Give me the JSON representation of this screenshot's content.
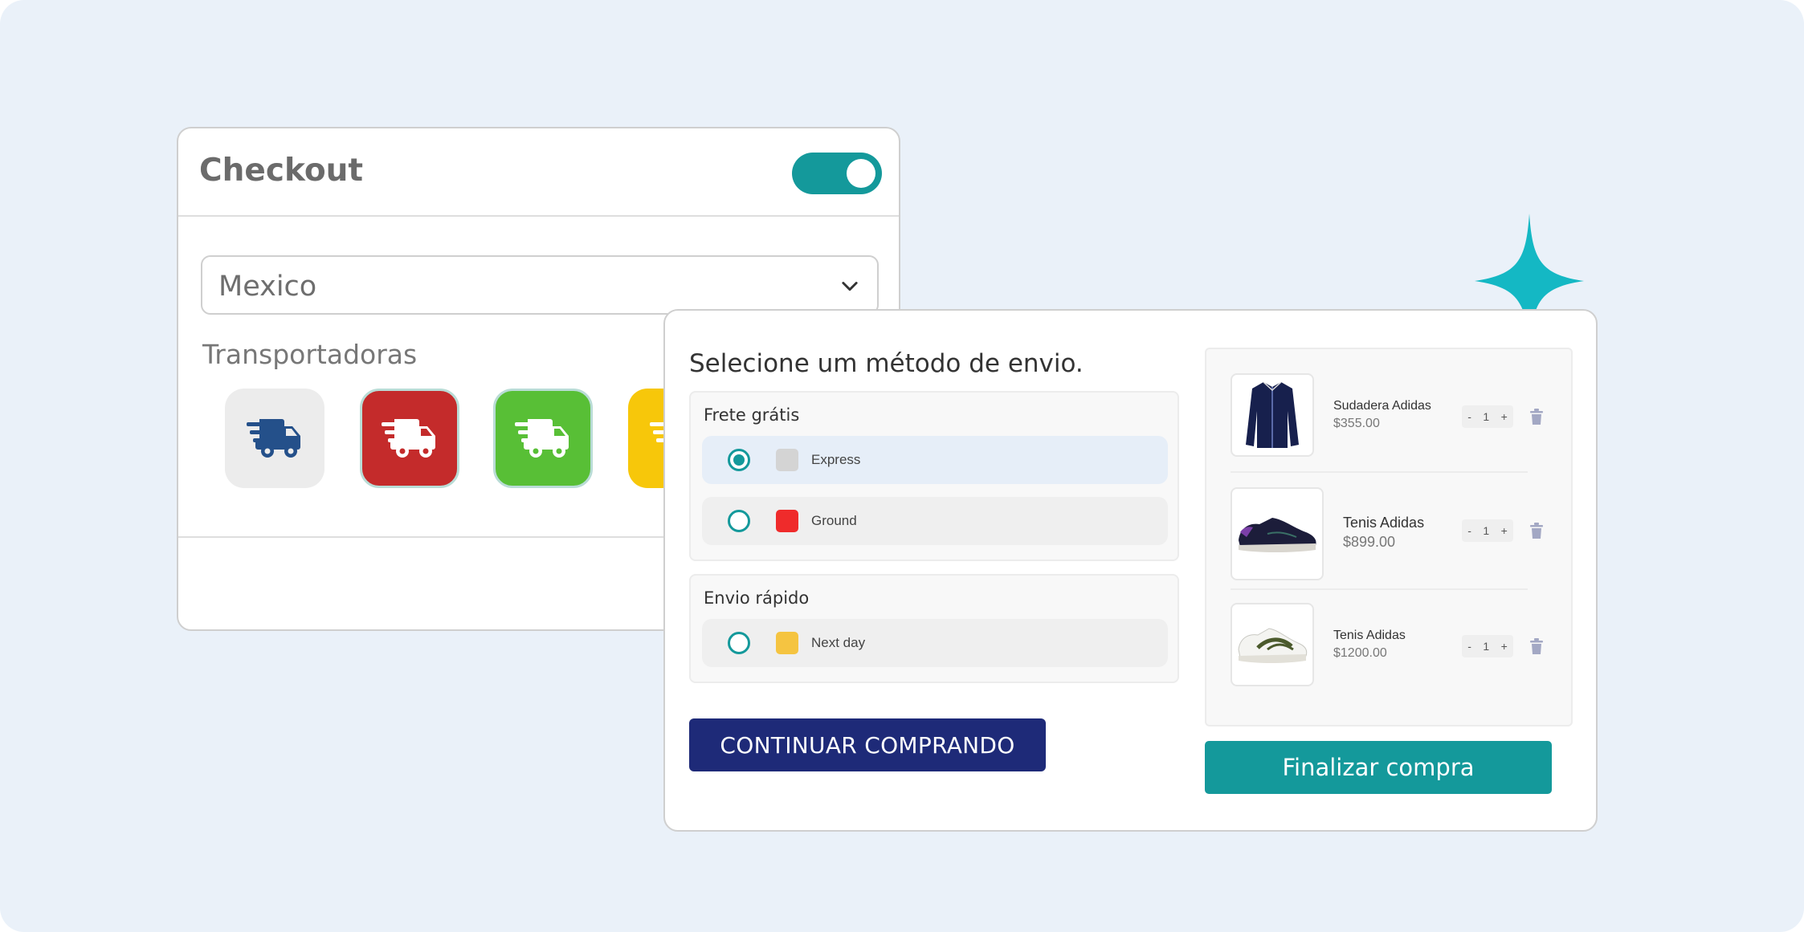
{
  "checkout": {
    "title": "Checkout",
    "toggle_on": true,
    "country_value": "Mexico",
    "carriers_label": "Transportadoras",
    "carriers": [
      {
        "icon": "truck-icon",
        "bg": "#ececec",
        "fg": "#24508a"
      },
      {
        "icon": "truck-icon",
        "bg": "#c42b2b",
        "fg": "#ffffff"
      },
      {
        "icon": "truck-icon",
        "bg": "#58bf36",
        "fg": "#ffffff"
      },
      {
        "icon": "truck-icon",
        "bg": "#f7c70a",
        "fg": "#ffffff"
      }
    ]
  },
  "shipping": {
    "title": "Selecione um método de envio.",
    "groups": [
      {
        "title": "Frete grátis",
        "options": [
          {
            "label": "Express",
            "swatch": "#d4d4d4",
            "selected": true
          },
          {
            "label": "Ground",
            "swatch": "#ef2b2b",
            "selected": false
          }
        ]
      },
      {
        "title": "Envio rápido",
        "options": [
          {
            "label": "Next day",
            "swatch": "#f5c441",
            "selected": false
          }
        ]
      }
    ],
    "continue_label": "CONTINUAR COMPRANDO"
  },
  "cart": {
    "items": [
      {
        "name": "Sudadera Adidas",
        "price": "$355.00",
        "qty_minus": "-",
        "qty": "1",
        "qty_plus": "+"
      },
      {
        "name": "Tenis Adidas",
        "price": "$899.00",
        "qty_minus": "-",
        "qty": "1",
        "qty_plus": "+"
      },
      {
        "name": "Tenis Adidas",
        "price": "$1200.00",
        "qty_minus": "-",
        "qty": "1",
        "qty_plus": "+"
      }
    ],
    "finalize_label": "Finalizar compra"
  },
  "colors": {
    "accent": "#14999b",
    "navy_button": "#1e2a78",
    "sparkle": "#14b8c4",
    "background": "#eaf1f9"
  }
}
